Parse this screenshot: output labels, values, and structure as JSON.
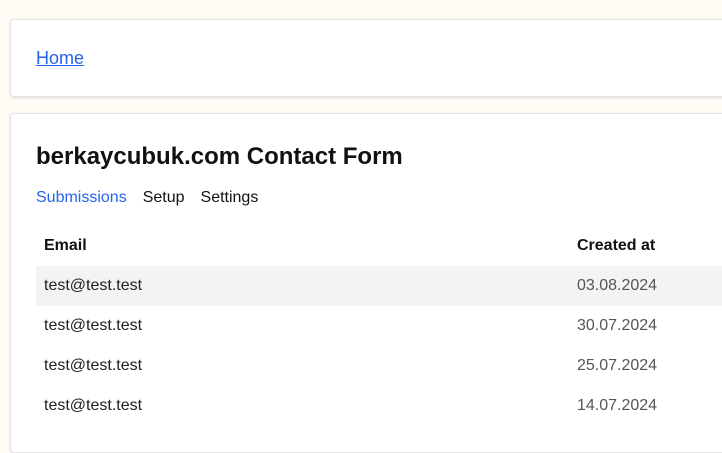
{
  "nav": {
    "home_label": "Home"
  },
  "main": {
    "title": "berkaycubuk.com Contact Form",
    "tabs": [
      {
        "label": "Submissions",
        "active": true
      },
      {
        "label": "Setup",
        "active": false
      },
      {
        "label": "Settings",
        "active": false
      }
    ],
    "table": {
      "headers": {
        "email": "Email",
        "created_at": "Created at"
      },
      "rows": [
        {
          "email": "test@test.test",
          "created_at": "03.08.2024"
        },
        {
          "email": "test@test.test",
          "created_at": "30.07.2024"
        },
        {
          "email": "test@test.test",
          "created_at": "25.07.2024"
        },
        {
          "email": "test@test.test",
          "created_at": "14.07.2024"
        }
      ]
    }
  },
  "colors": {
    "link": "#2563eb",
    "page_bg": "#fffbf5",
    "row_shade": "#f3f3f3"
  }
}
